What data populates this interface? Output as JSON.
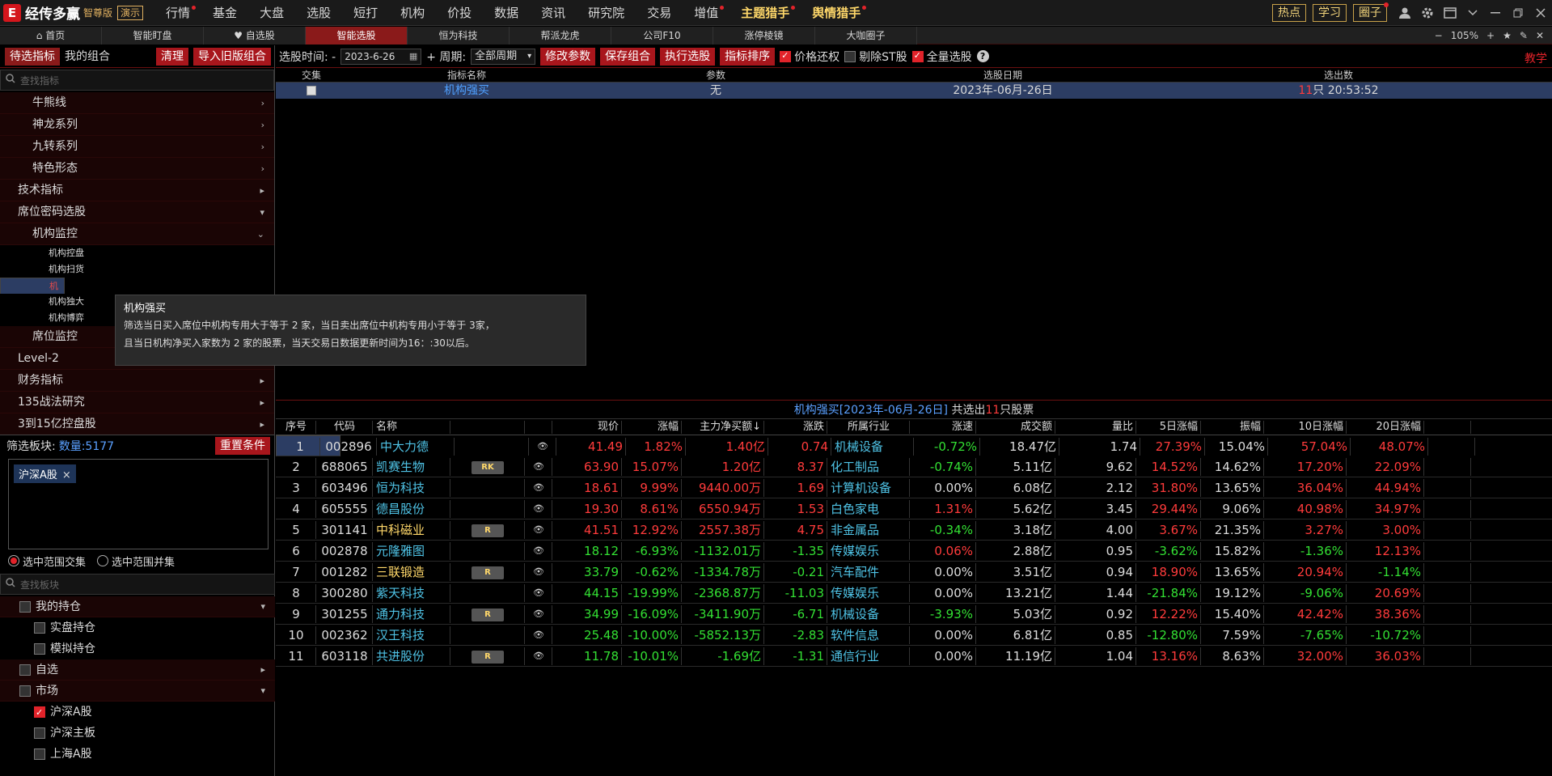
{
  "app": {
    "logo_mark": "E",
    "brand": "经传多赢",
    "edition": "智尊版",
    "demo": "演示"
  },
  "menu": [
    {
      "label": "行情",
      "dot": true,
      "hl": false
    },
    {
      "label": "基金",
      "dot": false,
      "hl": false
    },
    {
      "label": "大盘",
      "dot": false,
      "hl": false
    },
    {
      "label": "选股",
      "dot": false,
      "hl": false
    },
    {
      "label": "短打",
      "dot": false,
      "hl": false
    },
    {
      "label": "机构",
      "dot": false,
      "hl": false
    },
    {
      "label": "价投",
      "dot": false,
      "hl": false
    },
    {
      "label": "数据",
      "dot": false,
      "hl": false
    },
    {
      "label": "资讯",
      "dot": false,
      "hl": false
    },
    {
      "label": "研究院",
      "dot": false,
      "hl": false
    },
    {
      "label": "交易",
      "dot": false,
      "hl": false
    },
    {
      "label": "增值",
      "dot": true,
      "hl": false
    },
    {
      "label": "主题猎手",
      "dot": true,
      "hl": true
    },
    {
      "label": "舆情猎手",
      "dot": true,
      "hl": true
    }
  ],
  "topright": {
    "hot": "热点",
    "learn": "学习",
    "circle": "圈子"
  },
  "tabs": [
    "首页",
    "智能盯盘",
    "自选股",
    "智能选股",
    "恒为科技",
    "帮派龙虎",
    "公司F10",
    "涨停棱镜",
    "大咖圈子"
  ],
  "zoom": {
    "minus": "−",
    "value": "105%",
    "plus": "+"
  },
  "left": {
    "tab_pending": "待选指标",
    "tab_mine": "我的组合",
    "clear": "清理",
    "import_old": "导入旧版组合",
    "search_placeholder": "查找指标",
    "tree": [
      {
        "label": "牛熊线",
        "level": 2,
        "arrow": "›"
      },
      {
        "label": "神龙系列",
        "level": 2,
        "arrow": "›"
      },
      {
        "label": "九转系列",
        "level": 2,
        "arrow": "›"
      },
      {
        "label": "特色形态",
        "level": 2,
        "arrow": "›"
      },
      {
        "label": "技术指标",
        "level": 1,
        "arrow": "▸"
      },
      {
        "label": "席位密码选股",
        "level": 1,
        "arrow": "▾"
      },
      {
        "label": "机构监控",
        "level": 2,
        "arrow": "⌄"
      },
      {
        "label": "机构控盘",
        "level": 3,
        "arrow": ""
      },
      {
        "label": "机构扫货",
        "level": 3,
        "arrow": ""
      },
      {
        "label": "机构强买",
        "level": 3,
        "arrow": "",
        "selected": true
      },
      {
        "label": "机构独大",
        "level": 3,
        "arrow": ""
      },
      {
        "label": "机构博弈",
        "level": 3,
        "arrow": ""
      },
      {
        "label": "席位监控",
        "level": 2,
        "arrow": ""
      },
      {
        "label": "Level-2",
        "level": 1,
        "arrow": "▸"
      },
      {
        "label": "财务指标",
        "level": 1,
        "arrow": "▸"
      },
      {
        "label": "135战法研究",
        "level": 1,
        "arrow": "▸"
      },
      {
        "label": "3到15亿控盘股",
        "level": 1,
        "arrow": "▸"
      }
    ],
    "filter_label": "筛选板块:",
    "filter_count": "数量:5177",
    "reset": "重置条件",
    "chip": "沪深A股",
    "chip_close": "×",
    "radio_intersect": "选中范围交集",
    "radio_union": "选中范围并集",
    "search_board_placeholder": "查找板块",
    "boards": [
      {
        "label": "我的持仓",
        "level": 1,
        "arrow": "▾",
        "checked": false
      },
      {
        "label": "实盘持仓",
        "level": 2,
        "arrow": "",
        "checked": false
      },
      {
        "label": "模拟持仓",
        "level": 2,
        "arrow": "",
        "checked": false
      },
      {
        "label": "自选",
        "level": 1,
        "arrow": "▸",
        "checked": false
      },
      {
        "label": "市场",
        "level": 1,
        "arrow": "▾",
        "checked": false
      },
      {
        "label": "沪深A股",
        "level": 2,
        "arrow": "",
        "checked": true
      },
      {
        "label": "沪深主板",
        "level": 2,
        "arrow": "",
        "checked": false
      },
      {
        "label": "上海A股",
        "level": 2,
        "arrow": "",
        "checked": false
      }
    ]
  },
  "toolbar": {
    "time_label": "选股时间: -",
    "date": "2023-6-26",
    "period_label": "+ 周期:",
    "period": "全部周期",
    "modify": "修改参数",
    "save": "保存组合",
    "execute": "执行选股",
    "sort": "指标排序",
    "price_restore": "价格还权",
    "exclude_st": "剔除ST股",
    "full": "全量选股",
    "help": "?",
    "teach": "教学"
  },
  "upper": {
    "headers": [
      "交集",
      "指标名称",
      "参数",
      "选股日期",
      "选出数"
    ],
    "row": {
      "name": "机构强买",
      "param": "无",
      "date": "2023年-06月-26日",
      "count": "11",
      "count_suffix": "只 20:53:52"
    }
  },
  "result_bar": {
    "prefix": "机构强买[2023年-06月-26日]",
    "mid": " 共选出",
    "count": "11",
    "suffix": "只股票"
  },
  "columns": [
    "序号",
    "代码",
    "名称",
    "",
    "",
    "现价",
    "涨幅",
    "主力净买额↓",
    "涨跌",
    "所属行业",
    "涨速",
    "成交额",
    "量比",
    "5日涨幅",
    "振幅",
    "10日涨幅",
    "20日涨幅",
    ""
  ],
  "rows": [
    {
      "seq": "1",
      "code": "002896",
      "name": "中大力德",
      "tag": "",
      "price": "41.49",
      "chg": "1.82%",
      "net": "1.40亿",
      "diff": "0.74",
      "ind": "机械设备",
      "speed": "-0.72%",
      "amt": "18.47亿",
      "vr": "1.74",
      "d5": "27.39%",
      "amp": "15.04%",
      "d10": "57.04%",
      "d20": "48.07%",
      "dir": "up",
      "sdir": "dn",
      "d5dir": "up",
      "d10dir": "up",
      "d20dir": "up"
    },
    {
      "seq": "2",
      "code": "688065",
      "name": "凯赛生物",
      "tag": "RK",
      "price": "63.90",
      "chg": "15.07%",
      "net": "1.20亿",
      "diff": "8.37",
      "ind": "化工制品",
      "speed": "-0.74%",
      "amt": "5.11亿",
      "vr": "9.62",
      "d5": "14.52%",
      "amp": "14.62%",
      "d10": "17.20%",
      "d20": "22.09%",
      "dir": "up",
      "sdir": "dn",
      "d5dir": "up",
      "d10dir": "up",
      "d20dir": "up"
    },
    {
      "seq": "3",
      "code": "603496",
      "name": "恒为科技",
      "tag": "",
      "price": "18.61",
      "chg": "9.99%",
      "net": "9440.00万",
      "diff": "1.69",
      "ind": "计算机设备",
      "speed": "0.00%",
      "amt": "6.08亿",
      "vr": "2.12",
      "d5": "31.80%",
      "amp": "13.65%",
      "d10": "36.04%",
      "d20": "44.94%",
      "dir": "up",
      "sdir": "fl",
      "d5dir": "up",
      "d10dir": "up",
      "d20dir": "up"
    },
    {
      "seq": "4",
      "code": "605555",
      "name": "德昌股份",
      "tag": "",
      "price": "19.30",
      "chg": "8.61%",
      "net": "6550.94万",
      "diff": "1.53",
      "ind": "白色家电",
      "speed": "1.31%",
      "amt": "5.62亿",
      "vr": "3.45",
      "d5": "29.44%",
      "amp": "9.06%",
      "d10": "40.98%",
      "d20": "34.97%",
      "dir": "up",
      "sdir": "up",
      "d5dir": "up",
      "d10dir": "up",
      "d20dir": "up"
    },
    {
      "seq": "5",
      "code": "301141",
      "name": "中科磁业",
      "tag": "R",
      "price": "41.51",
      "chg": "12.92%",
      "net": "2557.38万",
      "diff": "4.75",
      "ind": "非金属品",
      "speed": "-0.34%",
      "amt": "3.18亿",
      "vr": "4.00",
      "d5": "3.67%",
      "amp": "21.35%",
      "d10": "3.27%",
      "d20": "3.00%",
      "dir": "up",
      "sdir": "dn",
      "d5dir": "up",
      "d10dir": "up",
      "d20dir": "up",
      "yellow": true
    },
    {
      "seq": "6",
      "code": "002878",
      "name": "元隆雅图",
      "tag": "",
      "price": "18.12",
      "chg": "-6.93%",
      "net": "-1132.01万",
      "diff": "-1.35",
      "ind": "传媒娱乐",
      "speed": "0.06%",
      "amt": "2.88亿",
      "vr": "0.95",
      "d5": "-3.62%",
      "amp": "15.82%",
      "d10": "-1.36%",
      "d20": "12.13%",
      "dir": "dn",
      "sdir": "up",
      "d5dir": "dn",
      "d10dir": "dn",
      "d20dir": "up"
    },
    {
      "seq": "7",
      "code": "001282",
      "name": "三联锻造",
      "tag": "R",
      "price": "33.79",
      "chg": "-0.62%",
      "net": "-1334.78万",
      "diff": "-0.21",
      "ind": "汽车配件",
      "speed": "0.00%",
      "amt": "3.51亿",
      "vr": "0.94",
      "d5": "18.90%",
      "amp": "13.65%",
      "d10": "20.94%",
      "d20": "-1.14%",
      "dir": "dn",
      "sdir": "fl",
      "d5dir": "up",
      "d10dir": "up",
      "d20dir": "dn",
      "yellow": true
    },
    {
      "seq": "8",
      "code": "300280",
      "name": "紫天科技",
      "tag": "",
      "price": "44.15",
      "chg": "-19.99%",
      "net": "-2368.87万",
      "diff": "-11.03",
      "ind": "传媒娱乐",
      "speed": "0.00%",
      "amt": "13.21亿",
      "vr": "1.44",
      "d5": "-21.84%",
      "amp": "19.12%",
      "d10": "-9.06%",
      "d20": "20.69%",
      "dir": "dn",
      "sdir": "fl",
      "d5dir": "dn",
      "d10dir": "dn",
      "d20dir": "up"
    },
    {
      "seq": "9",
      "code": "301255",
      "name": "通力科技",
      "tag": "R",
      "price": "34.99",
      "chg": "-16.09%",
      "net": "-3411.90万",
      "diff": "-6.71",
      "ind": "机械设备",
      "speed": "-3.93%",
      "amt": "5.03亿",
      "vr": "0.92",
      "d5": "12.22%",
      "amp": "15.40%",
      "d10": "42.42%",
      "d20": "38.36%",
      "dir": "dn",
      "sdir": "dn",
      "d5dir": "up",
      "d10dir": "up",
      "d20dir": "up"
    },
    {
      "seq": "10",
      "code": "002362",
      "name": "汉王科技",
      "tag": "",
      "price": "25.48",
      "chg": "-10.00%",
      "net": "-5852.13万",
      "diff": "-2.83",
      "ind": "软件信息",
      "speed": "0.00%",
      "amt": "6.81亿",
      "vr": "0.85",
      "d5": "-12.80%",
      "amp": "7.59%",
      "d10": "-7.65%",
      "d20": "-10.72%",
      "dir": "dn",
      "sdir": "fl",
      "d5dir": "dn",
      "d10dir": "dn",
      "d20dir": "dn"
    },
    {
      "seq": "11",
      "code": "603118",
      "name": "共进股份",
      "tag": "R",
      "price": "11.78",
      "chg": "-10.01%",
      "net": "-1.69亿",
      "diff": "-1.31",
      "ind": "通信行业",
      "speed": "0.00%",
      "amt": "11.19亿",
      "vr": "1.04",
      "d5": "13.16%",
      "amp": "8.63%",
      "d10": "32.00%",
      "d20": "36.03%",
      "dir": "dn",
      "sdir": "fl",
      "d5dir": "up",
      "d10dir": "up",
      "d20dir": "up"
    }
  ],
  "tooltip": {
    "title": "机构强买",
    "line1": "筛选当日买入席位中机构专用大于等于 2 家，当日卖出席位中机构专用小于等于 3家，",
    "line2": "且当日机构净买入家数为 2 家的股票，当天交易日数据更新时间为16：:30以后。"
  },
  "colors": {
    "accent_red": "#a8161c",
    "up": "#ff3b3b",
    "down": "#33e033",
    "name": "#4fc3e6",
    "selected_row": "#2c3d63"
  }
}
